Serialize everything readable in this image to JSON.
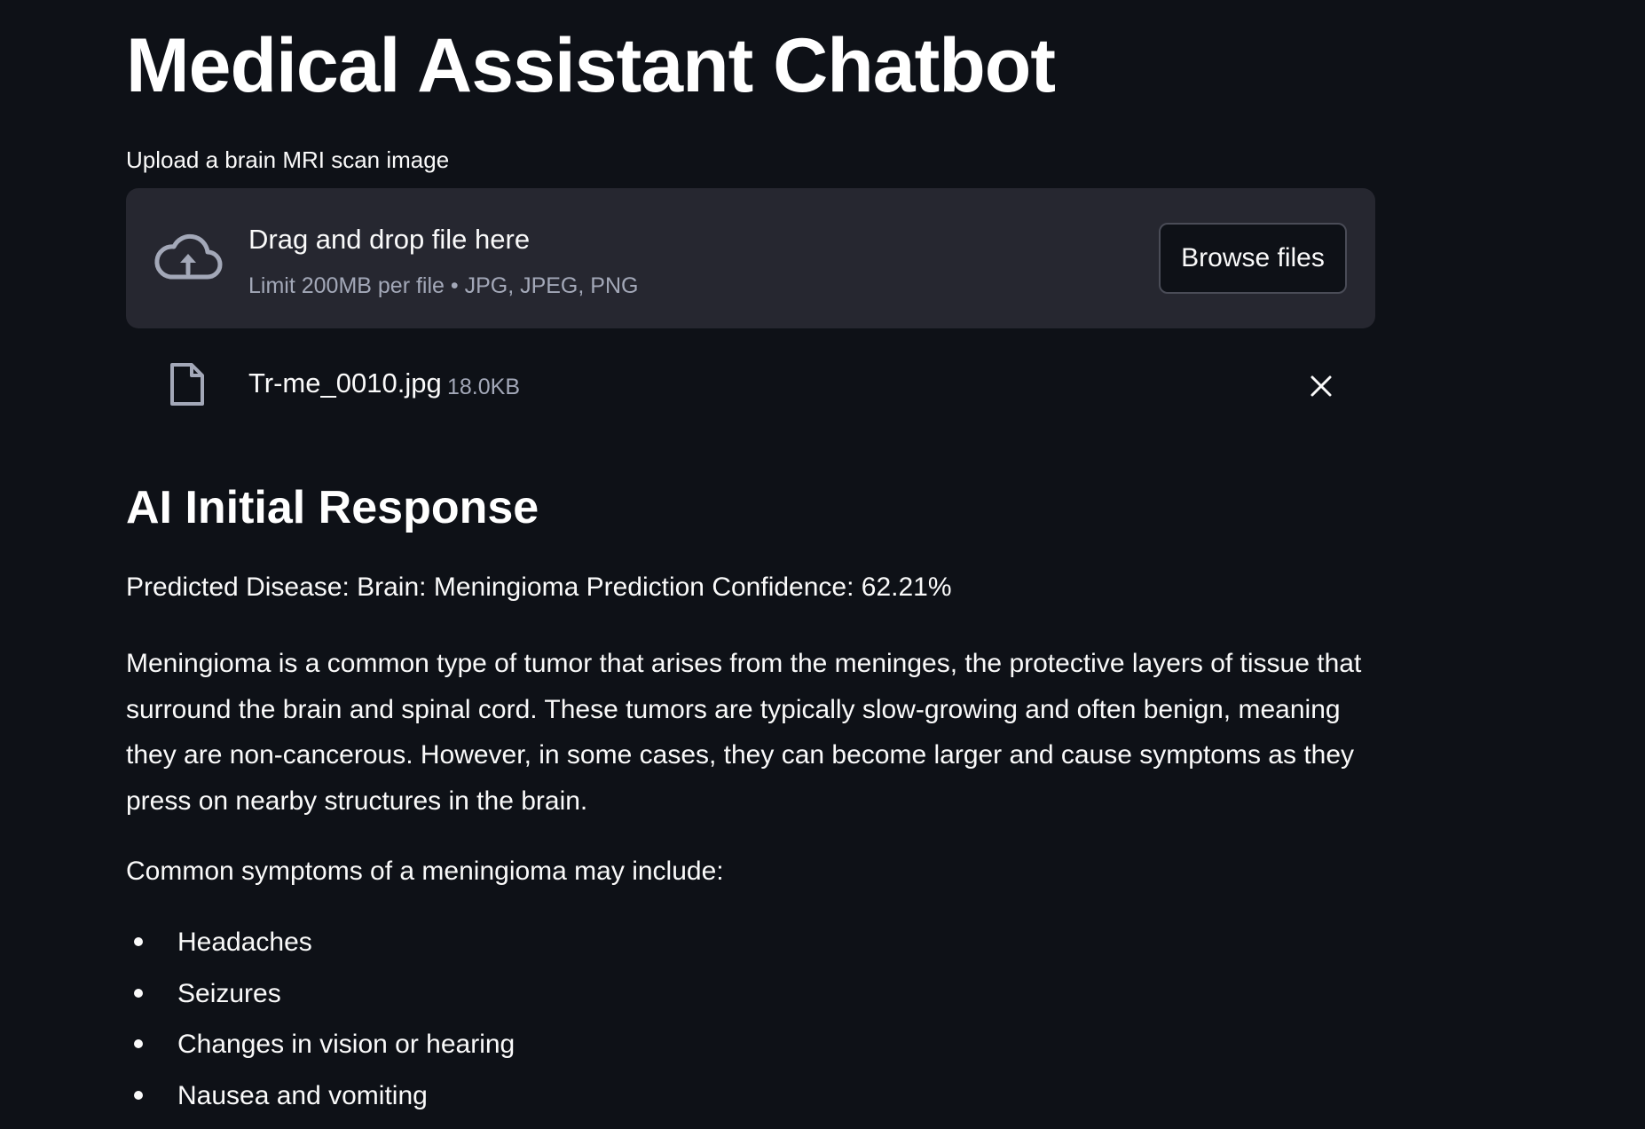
{
  "app": {
    "title": "Medical Assistant Chatbot"
  },
  "uploader": {
    "label": "Upload a brain MRI scan image",
    "drop_title": "Drag and drop file here",
    "limit_text": "Limit 200MB per file • JPG, JPEG, PNG",
    "browse_label": "Browse files",
    "cloud_icon": "cloud-upload-icon"
  },
  "uploaded_file": {
    "name": "Tr-me_0010.jpg",
    "size": "18.0KB",
    "file_icon": "file-icon",
    "remove_icon": "close-icon"
  },
  "response": {
    "heading": "AI Initial Response",
    "prediction": "Predicted Disease: Brain: Meningioma Prediction Confidence: 62.21%",
    "description": "Meningioma is a common type of tumor that arises from the meninges, the protective layers of tissue that surround the brain and spinal cord. These tumors are typically slow-growing and often benign, meaning they are non-cancerous. However, in some cases, they can become larger and cause symptoms as they press on nearby structures in the brain.",
    "symptoms_intro": "Common symptoms of a meningioma may include:",
    "symptoms": [
      "Headaches",
      "Seizures",
      "Changes in vision or hearing",
      "Nausea and vomiting"
    ]
  },
  "colors": {
    "background": "#0e1117",
    "dropzone": "#262730",
    "muted_text": "#a3a8b8",
    "text": "#fafafa"
  }
}
